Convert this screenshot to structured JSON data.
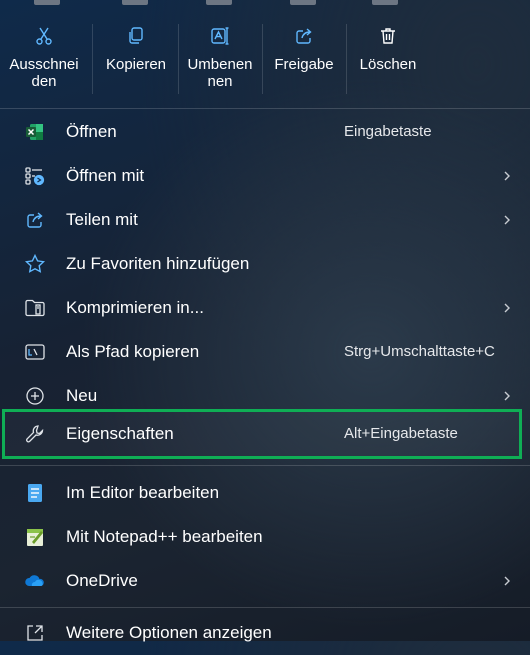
{
  "toolbar": {
    "buttons": [
      {
        "id": "cut",
        "label": "Ausschnei\nden",
        "icon": "scissors-icon"
      },
      {
        "id": "copy",
        "label": "Kopieren",
        "icon": "copy-icon"
      },
      {
        "id": "rename",
        "label": "Umbenen\nnen",
        "icon": "rename-icon"
      },
      {
        "id": "share",
        "label": "Freigabe",
        "icon": "share-icon"
      },
      {
        "id": "delete",
        "label": "Löschen",
        "icon": "trash-icon"
      }
    ]
  },
  "menu": {
    "items": [
      {
        "label": "Öffnen",
        "shortcut": "Eingabetaste",
        "icon": "excel-icon",
        "submenu": false
      },
      {
        "label": "Öffnen mit",
        "shortcut": "",
        "icon": "open-with-icon",
        "submenu": true
      },
      {
        "label": "Teilen mit",
        "shortcut": "",
        "icon": "share-icon",
        "submenu": true
      },
      {
        "label": "Zu Favoriten hinzufügen",
        "shortcut": "",
        "icon": "star-icon",
        "submenu": false
      },
      {
        "label": "Komprimieren in...",
        "shortcut": "",
        "icon": "zip-folder-icon",
        "submenu": true
      },
      {
        "label": "Als Pfad kopieren",
        "shortcut": "Strg+Umschalttaste+C",
        "icon": "path-icon",
        "submenu": false
      },
      {
        "label": "Neu",
        "shortcut": "",
        "icon": "plus-circle-icon",
        "submenu": true
      },
      {
        "label": "Eigenschaften",
        "shortcut": "Alt+Eingabetaste",
        "icon": "wrench-icon",
        "submenu": false
      },
      {
        "label": "Im Editor bearbeiten",
        "shortcut": "",
        "icon": "notepad-icon",
        "submenu": false
      },
      {
        "label": "Mit Notepad++ bearbeiten",
        "shortcut": "",
        "icon": "notepadpp-icon",
        "submenu": false
      },
      {
        "label": "OneDrive",
        "shortcut": "",
        "icon": "onedrive-icon",
        "submenu": true
      },
      {
        "label": "Weitere Optionen anzeigen",
        "shortcut": "",
        "icon": "more-options-icon",
        "submenu": false
      }
    ]
  },
  "colors": {
    "highlight_border": "#0fae55",
    "icon_accent": "#60b8ff"
  }
}
